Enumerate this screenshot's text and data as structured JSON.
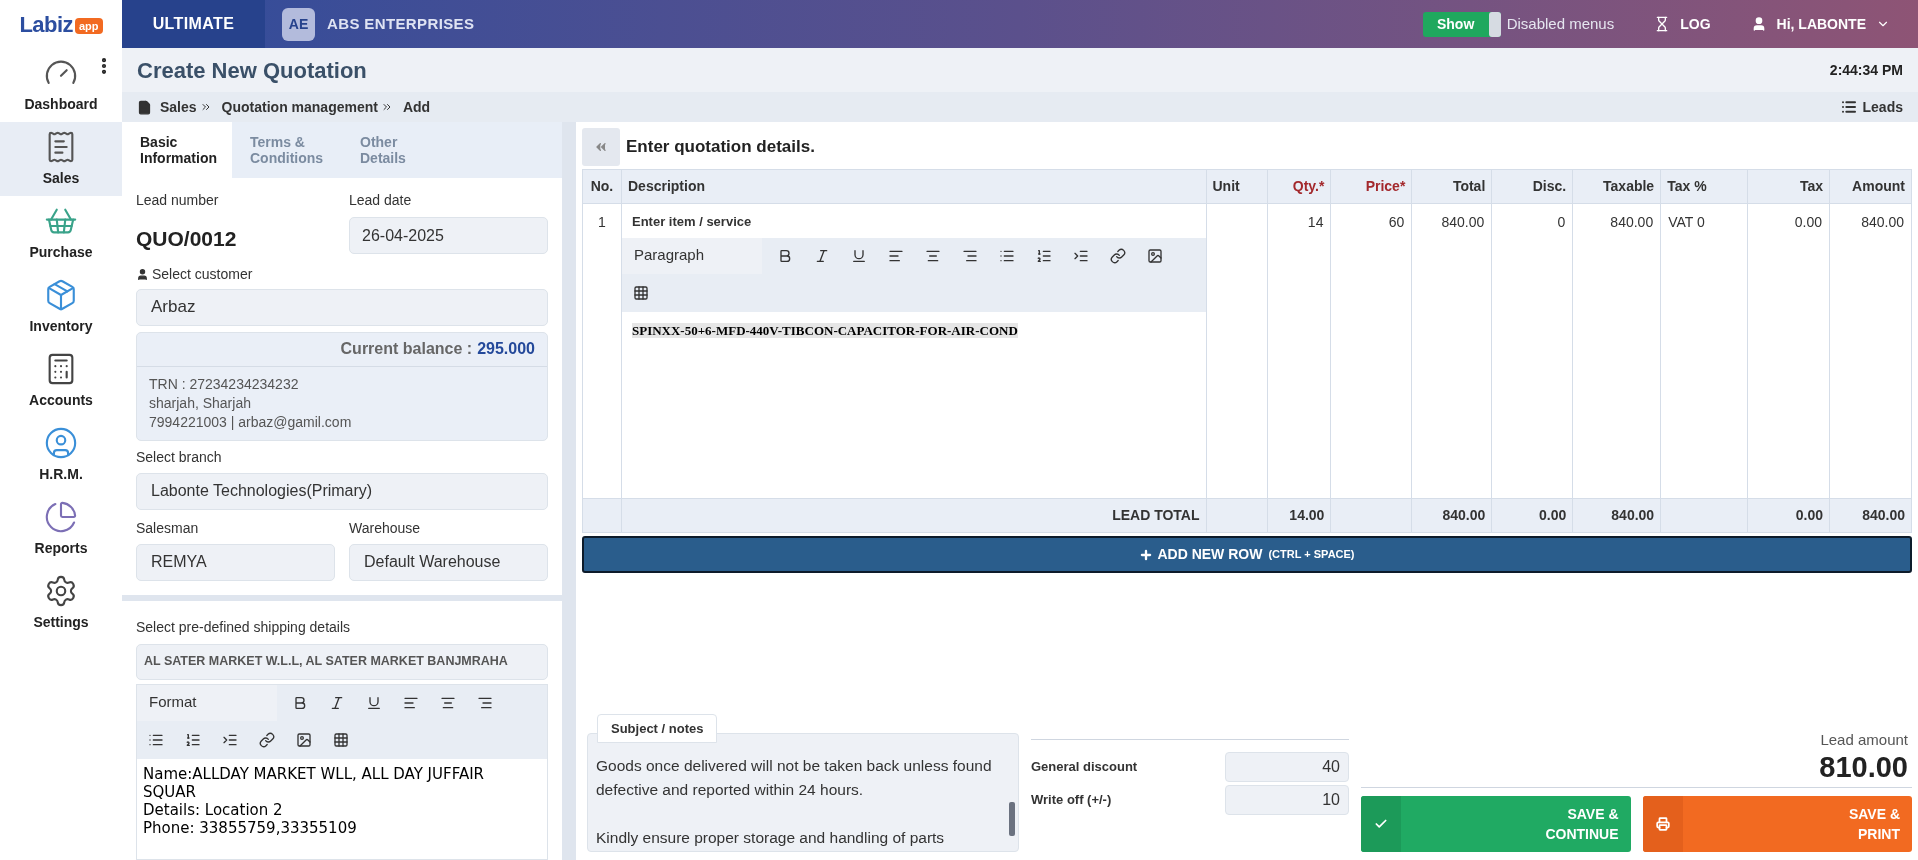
{
  "topbar": {
    "logo": {
      "name": "Labiz",
      "badge": "app"
    },
    "plan": "ULTIMATE",
    "company": {
      "initials": "AE",
      "name": "ABS ENTERPRISES"
    },
    "toggle": {
      "label": "Show",
      "on": true
    },
    "toggle_caption": "Disabled menus",
    "log": "LOG",
    "user": "Hi, LABONTE"
  },
  "sidebar": {
    "items": [
      {
        "kind": "dashboard",
        "label": "Dashboard",
        "selected": false
      },
      {
        "kind": "sales",
        "label": "Sales",
        "selected": true
      },
      {
        "kind": "purchase",
        "label": "Purchase",
        "selected": false
      },
      {
        "kind": "inventory",
        "label": "Inventory",
        "selected": false
      },
      {
        "kind": "accounts",
        "label": "Accounts",
        "selected": false
      },
      {
        "kind": "hrm",
        "label": "H.R.M.",
        "selected": false
      },
      {
        "kind": "reports",
        "label": "Reports",
        "selected": false
      },
      {
        "kind": "settings",
        "label": "Settings",
        "selected": false
      }
    ]
  },
  "page": {
    "title": "Create New Quotation",
    "time": "2:44:34 PM",
    "breadcrumb": [
      "Sales",
      "Quotation management",
      "Add"
    ],
    "leads_link": "Leads"
  },
  "form": {
    "tabs": [
      {
        "label": "Basic Information",
        "selected": true
      },
      {
        "label": "Terms & Conditions",
        "selected": false
      },
      {
        "label": "Other Details",
        "selected": false
      }
    ],
    "lead_number": {
      "label": "Lead number",
      "value": "QUO/0012"
    },
    "lead_date": {
      "label": "Lead date",
      "value": "26-04-2025"
    },
    "customer": {
      "label": "Select customer",
      "value": "Arbaz"
    },
    "balance": {
      "label": "Current balance :",
      "value": "295.000"
    },
    "customer_details": [
      "TRN : 27234234234232",
      "sharjah, Sharjah",
      "7994221003 | arbaz@gamil.com"
    ],
    "branch": {
      "label": "Select branch",
      "value": "Labonte Technologies(Primary)"
    },
    "salesman": {
      "label": "Salesman",
      "value": "REMYA"
    },
    "warehouse": {
      "label": "Warehouse",
      "value": "Default Warehouse"
    },
    "shipping": {
      "label": "Select pre-defined shipping details",
      "value": "AL SATER MARKET W.L.L, AL SATER MARKET BANJMRAHA",
      "format_label": "Format",
      "address": [
        "Name:ALLDAY MARKET WLL, ALL DAY JUFFAIR SQUAR",
        "Details: Location 2",
        "Phone: 33855759,33355109"
      ]
    }
  },
  "items": {
    "heading": "Enter quotation details.",
    "columns": [
      {
        "label": "No.",
        "required": false
      },
      {
        "label": "Description",
        "required": false
      },
      {
        "label": "Unit",
        "required": false
      },
      {
        "label": "Qty.*",
        "required": true
      },
      {
        "label": "Price*",
        "required": true
      },
      {
        "label": "Total",
        "required": false
      },
      {
        "label": "Disc.",
        "required": false
      },
      {
        "label": "Taxable",
        "required": false
      },
      {
        "label": "Tax %",
        "required": false
      },
      {
        "label": "Tax",
        "required": false
      },
      {
        "label": "Amount",
        "required": false
      }
    ],
    "rows": [
      {
        "no": "1",
        "item_label": "Enter item / service",
        "editor_format": "Paragraph",
        "description": "SPINXX-50+6-MFD-440V-TIBCON-CAPACITOR-FOR-AIR-COND",
        "qty": "14",
        "price": "60",
        "total": "840.00",
        "disc": "0",
        "taxable": "840.00",
        "tax_pct": "VAT 0",
        "tax": "0.00",
        "amount": "840.00"
      }
    ],
    "footer": {
      "label": "LEAD TOTAL",
      "qty": "14.00",
      "total": "840.00",
      "disc": "0.00",
      "taxable": "840.00",
      "tax": "0.00",
      "amount": "840.00"
    },
    "add_row": {
      "label": "ADD NEW ROW",
      "shortcut": "(CTRL + SPACE)"
    }
  },
  "summary": {
    "notes": {
      "label": "Subject / notes",
      "paragraphs": [
        "Goods once delivered will not be taken back unless found defective and reported within 24 hours.",
        "Kindly ensure proper storage and handling of parts"
      ]
    },
    "general_discount": {
      "label": "General discount",
      "value": "40"
    },
    "write_off": {
      "label": "Write off (+/-)",
      "value": "10"
    },
    "lead_amount": {
      "label": "Lead amount",
      "value": "810.00"
    },
    "buttons": [
      {
        "kind": "continue",
        "label": "SAVE & CONTINUE"
      },
      {
        "kind": "print",
        "label": "SAVE & PRINT"
      }
    ]
  }
}
